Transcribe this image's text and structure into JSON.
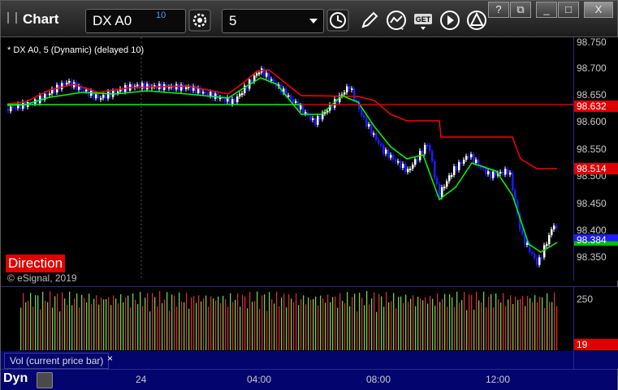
{
  "window": {
    "title": "Chart",
    "minimize_label": "_",
    "maximize_label": "□",
    "close_label": "X",
    "help_label": "?",
    "restore_label": "⧉"
  },
  "toolbar": {
    "symbol": "DX A0",
    "symbol_superscript": "10",
    "interval": "5",
    "icons": [
      "gear-icon",
      "clock-icon",
      "pencil-icon",
      "line-tool-icon",
      "get-icon",
      "play-icon",
      "alert-icon"
    ]
  },
  "chart": {
    "study_label": "* DX A0, 5 (Dynamic) (delayed 10)",
    "direction_label": "Direction",
    "copyright": "© eSignal, 2019",
    "price_ticks": [
      "98.750",
      "98.700",
      "98.650",
      "98.600",
      "98.550",
      "98.500",
      "98.450",
      "98.400",
      "98.350"
    ],
    "price_tags": {
      "red_upper": "98.632",
      "red_lower": "98.514",
      "last_price": "98.384"
    },
    "colors": {
      "up_bar": "#ffffff",
      "down_bar": "#1c1cff",
      "red_line": "#ff0000",
      "green_line": "#00ff00",
      "axis_bg": "#04046e"
    }
  },
  "volume": {
    "label": "Vol (current price bar)",
    "close_label": "×",
    "tick": "250",
    "last_value": "19"
  },
  "time_axis": {
    "labels": [
      "24",
      "04:00",
      "08:00",
      "12:00"
    ]
  },
  "status": {
    "dyn_label": "Dyn"
  }
}
